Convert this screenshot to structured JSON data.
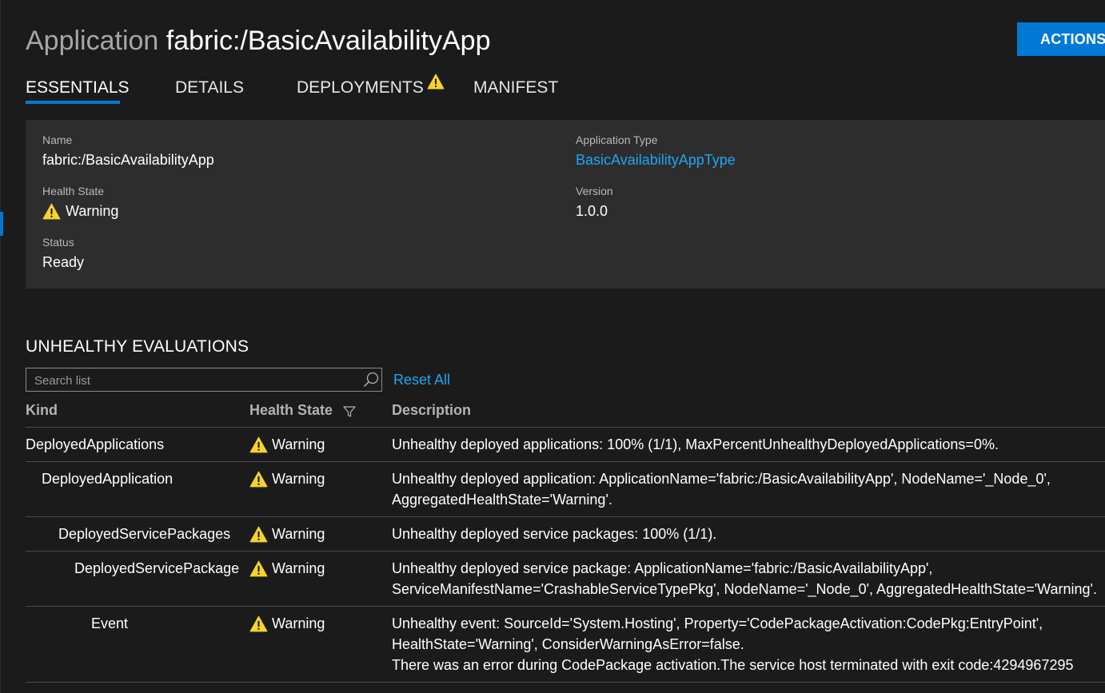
{
  "header": {
    "kind_label": "Application",
    "name": "fabric:/BasicAvailabilityApp",
    "actions_label": "ACTIONS"
  },
  "tabs": [
    {
      "label": "ESSENTIALS",
      "active": true
    },
    {
      "label": "DETAILS",
      "active": false
    },
    {
      "label": "DEPLOYMENTS",
      "active": false,
      "warning": true
    },
    {
      "label": "MANIFEST",
      "active": false
    }
  ],
  "essentials": {
    "name_label": "Name",
    "name_value": "fabric:/BasicAvailabilityApp",
    "health_label": "Health State",
    "health_value": "Warning",
    "status_label": "Status",
    "status_value": "Ready",
    "apptype_label": "Application Type",
    "apptype_value": "BasicAvailabilityAppType",
    "version_label": "Version",
    "version_value": "1.0.0"
  },
  "unhealthy": {
    "heading": "UNHEALTHY EVALUATIONS",
    "search_placeholder": "Search list",
    "reset_label": "Reset All",
    "columns": {
      "kind": "Kind",
      "health": "Health State",
      "description": "Description"
    },
    "rows": [
      {
        "kind": "DeployedApplications",
        "health": "Warning",
        "description": [
          "Unhealthy deployed applications: 100% (1/1), MaxPercentUnhealthyDeployedApplications=0%."
        ]
      },
      {
        "kind": "DeployedApplication",
        "health": "Warning",
        "description": [
          "Unhealthy deployed application: ApplicationName='fabric:/BasicAvailabilityApp', NodeName='_Node_0',",
          "AggregatedHealthState='Warning'."
        ]
      },
      {
        "kind": "DeployedServicePackages",
        "health": "Warning",
        "description": [
          "Unhealthy deployed service packages: 100% (1/1)."
        ]
      },
      {
        "kind": "DeployedServicePackage",
        "health": "Warning",
        "description": [
          "Unhealthy deployed service package: ApplicationName='fabric:/BasicAvailabilityApp',",
          "ServiceManifestName='CrashableServiceTypePkg', NodeName='_Node_0', AggregatedHealthState='Warning'."
        ]
      },
      {
        "kind": "Event",
        "health": "Warning",
        "description": [
          "Unhealthy event: SourceId='System.Hosting', Property='CodePackageActivation:CodePkg:EntryPoint',",
          "HealthState='Warning', ConsiderWarningAsError=false.",
          "There was an error during CodePackage activation.The service host terminated with exit code:4294967295"
        ]
      }
    ]
  },
  "colors": {
    "accent": "#0078d4",
    "link": "#1ea5ee",
    "warning": "#f6d32d",
    "panel": "#2d2d2e",
    "background": "#1b1b1c"
  }
}
